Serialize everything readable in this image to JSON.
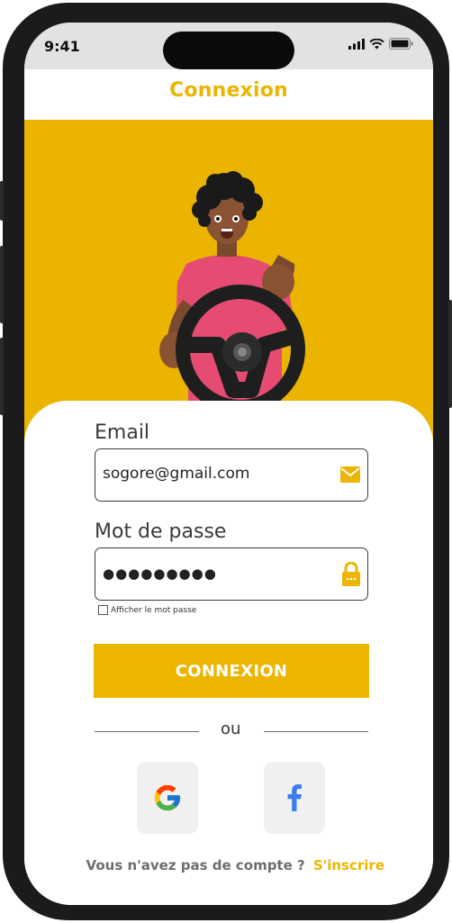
{
  "status_bar": {
    "time": "9:41"
  },
  "header": {
    "title": "Connexion"
  },
  "form": {
    "email": {
      "label": "Email",
      "value": "sogore@gmail.com"
    },
    "password": {
      "label": "Mot de passe",
      "value": "●●●●●●●●●"
    },
    "show_password": {
      "label": "Afficher le mot passe",
      "checked": false
    },
    "submit_label": "CONNEXION"
  },
  "divider": {
    "text": "ou"
  },
  "signup": {
    "prompt": "Vous n'avez pas de compte ?",
    "link": "S'inscrire"
  },
  "icons": {
    "email": "envelope-icon",
    "password": "padlock-icon",
    "google": "google-logo-icon",
    "facebook": "facebook-logo-icon"
  },
  "colors": {
    "accent": "#ecb500",
    "hero_bg": "#ebb401",
    "text_dark": "#3a3a3a",
    "text_muted": "#6e6e6e"
  }
}
